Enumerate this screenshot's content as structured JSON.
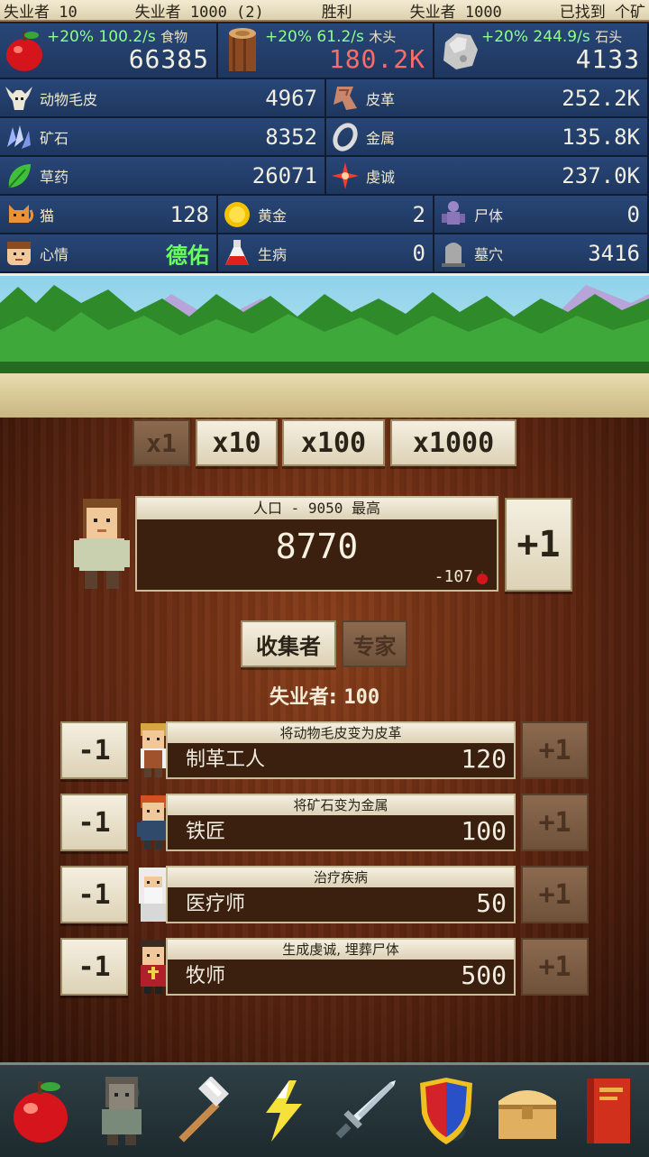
{
  "topbar": {
    "items": [
      "失业者 10",
      "失业者 1000 (2)",
      "胜利",
      "失业者 1000",
      "已找到 个矿"
    ]
  },
  "resources": {
    "food": {
      "rate": "+20% 100.2/s",
      "name": "食物",
      "value": "66385",
      "icon": "apple-icon"
    },
    "wood": {
      "rate": "+20% 61.2/s",
      "name": "木头",
      "value": "180.2K",
      "icon": "log-icon"
    },
    "stone": {
      "rate": "+20% 244.9/s",
      "name": "石头",
      "value": "4133",
      "icon": "stone-icon"
    },
    "rows": [
      {
        "left": {
          "label": "动物毛皮",
          "value": "4967",
          "icon": "skull-icon"
        },
        "right": {
          "label": "皮革",
          "value": "252.2K",
          "icon": "leather-icon"
        }
      },
      {
        "left": {
          "label": "矿石",
          "value": "8352",
          "icon": "ore-icon"
        },
        "right": {
          "label": "金属",
          "value": "135.8K",
          "icon": "metal-ring-icon"
        }
      },
      {
        "left": {
          "label": "草药",
          "value": "26071",
          "icon": "herb-icon"
        },
        "right": {
          "label": "虔诚",
          "value": "237.0K",
          "icon": "cross-icon"
        }
      }
    ],
    "row4": [
      {
        "label": "猫",
        "value": "128",
        "icon": "cat-icon"
      },
      {
        "label": "黄金",
        "value": "2",
        "icon": "gold-coin-icon"
      },
      {
        "label": "尸体",
        "value": "0",
        "icon": "corpse-icon"
      }
    ],
    "row5": [
      {
        "label": "心情",
        "value": "德佑",
        "icon": "face-icon"
      },
      {
        "label": "生病",
        "value": "0",
        "icon": "potion-icon"
      },
      {
        "label": "墓穴",
        "value": "3416",
        "icon": "grave-icon"
      }
    ]
  },
  "multipliers": [
    "x1",
    "x10",
    "x100",
    "x1000"
  ],
  "population": {
    "header": "人口 - 9050 最高",
    "value": "8770",
    "delta": "-107",
    "plus_label": "+1"
  },
  "tabs": {
    "gatherers": "收集者",
    "experts": "专家"
  },
  "unemployed": {
    "label": "失业者:",
    "value": "100"
  },
  "jobs": [
    {
      "desc": "将动物毛皮变为皮革",
      "name": "制革工人",
      "count": "120",
      "minus": "-1",
      "plus": "+1"
    },
    {
      "desc": "将矿石变为金属",
      "name": "铁匠",
      "count": "100",
      "minus": "-1",
      "plus": "+1"
    },
    {
      "desc": "治疗疾病",
      "name": "医疗师",
      "count": "50",
      "minus": "-1",
      "plus": "+1"
    },
    {
      "desc": "生成虔诚, 埋葬尸体",
      "name": "牧师",
      "count": "500",
      "minus": "-1",
      "plus": "+1"
    }
  ],
  "nav": [
    "apple-icon",
    "villager-icon",
    "hammer-icon",
    "lightning-icon",
    "sword-icon",
    "shield-icon",
    "chest-icon",
    "book-icon"
  ],
  "colors": {
    "rate_green": "#8dff8d",
    "warning_red": "#ff6b6b",
    "mood_green": "#69ff5f",
    "panel_blue": "#284677",
    "wood_brown": "#5c2510"
  }
}
